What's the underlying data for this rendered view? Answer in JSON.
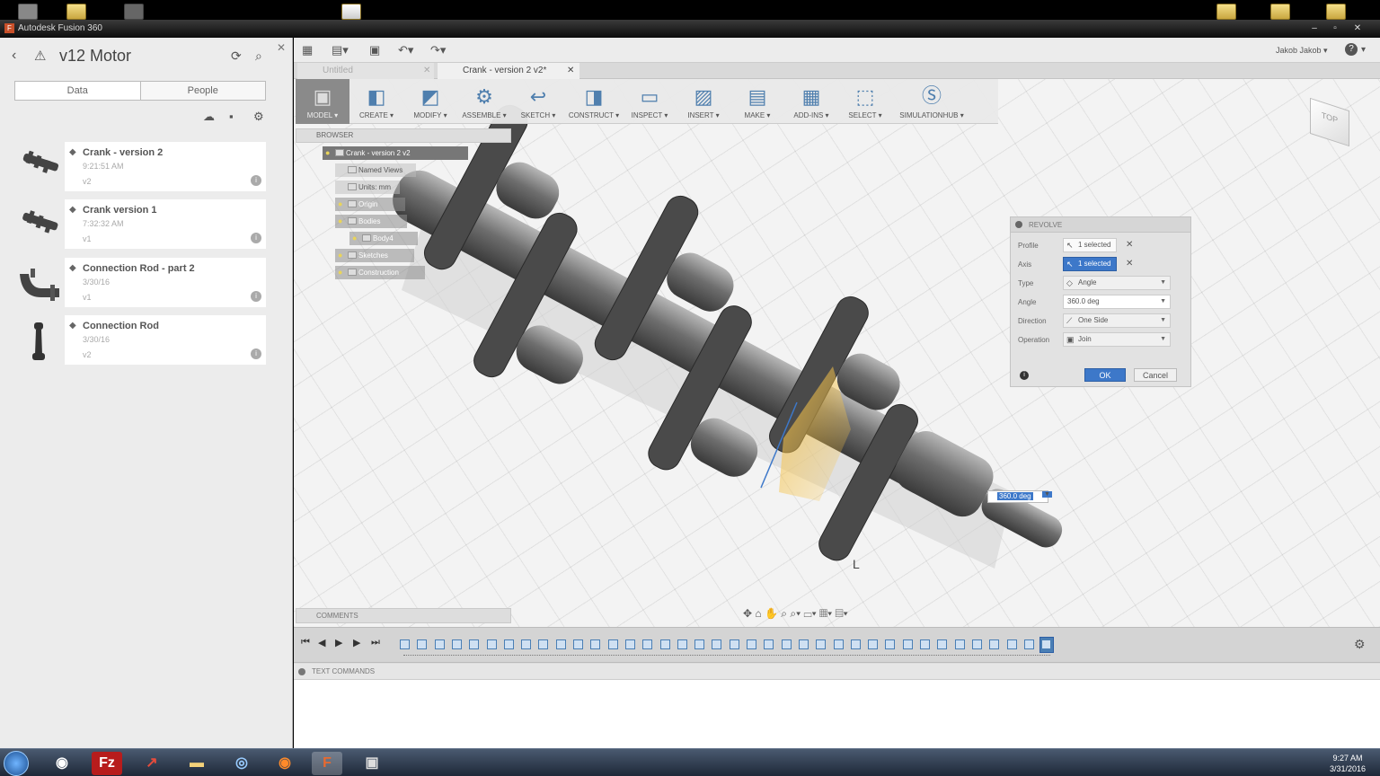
{
  "window": {
    "title": "Autodesk Fusion 360"
  },
  "data_panel": {
    "project_title": "v12 Motor",
    "tabs": [
      {
        "label": "Data"
      },
      {
        "label": "People"
      }
    ],
    "files": [
      {
        "name": "Crank - version 2",
        "time": "9:21:51 AM",
        "version": "v2"
      },
      {
        "name": "Crank version 1",
        "time": "7:32:32 AM",
        "version": "v1"
      },
      {
        "name": "Connection Rod - part 2",
        "time": "3/30/16",
        "version": "v1"
      },
      {
        "name": "Connection Rod",
        "time": "3/30/16",
        "version": "v2"
      }
    ]
  },
  "header": {
    "user": "Jakob Jakob ▾"
  },
  "doc_tabs": [
    {
      "label": "Untitled"
    },
    {
      "label": "Crank - version 2 v2*"
    }
  ],
  "toolbar": [
    {
      "label": "MODEL ▾",
      "icon": "model-icon",
      "glyph": "▣"
    },
    {
      "label": "CREATE ▾",
      "icon": "create-icon",
      "glyph": "◧"
    },
    {
      "label": "MODIFY ▾",
      "icon": "modify-icon",
      "glyph": "◩"
    },
    {
      "label": "ASSEMBLE ▾",
      "icon": "assemble-icon",
      "glyph": "⚙"
    },
    {
      "label": "SKETCH ▾",
      "icon": "sketch-icon",
      "glyph": "↩"
    },
    {
      "label": "CONSTRUCT ▾",
      "icon": "construct-icon",
      "glyph": "◨"
    },
    {
      "label": "INSPECT ▾",
      "icon": "inspect-icon",
      "glyph": "▭"
    },
    {
      "label": "INSERT ▾",
      "icon": "insert-icon",
      "glyph": "▨"
    },
    {
      "label": "MAKE ▾",
      "icon": "make-icon",
      "glyph": "▤"
    },
    {
      "label": "ADD-INS ▾",
      "icon": "addins-icon",
      "glyph": "▦"
    },
    {
      "label": "SELECT ▾",
      "icon": "select-icon",
      "glyph": "⬚"
    },
    {
      "label": "SIMULATIONHUB ▾",
      "icon": "simulationhub-icon",
      "glyph": "Ⓢ"
    }
  ],
  "browser": {
    "title": "BROWSER",
    "root": "Crank - version 2 v2",
    "nodes": [
      "Named Views",
      "Units: mm",
      "Origin",
      "Bodies",
      "Body4",
      "Sketches",
      "Construction"
    ]
  },
  "viewcube": {
    "face": "TOP"
  },
  "revolve": {
    "title": "REVOLVE",
    "rows": [
      {
        "label": "Profile",
        "value": "1 selected"
      },
      {
        "label": "Axis",
        "value": "1 selected"
      },
      {
        "label": "Type",
        "value": "Angle"
      },
      {
        "label": "Angle",
        "value": "360.0 deg"
      },
      {
        "label": "Direction",
        "value": "One Side"
      },
      {
        "label": "Operation",
        "value": "Join"
      }
    ],
    "ok": "OK",
    "cancel": "Cancel"
  },
  "angle_input": "360.0 deg",
  "comments": "COMMENTS",
  "text_commands": "TEXT COMMANDS",
  "clock": {
    "time": "9:27 AM",
    "date": "3/31/2016"
  },
  "colors": {
    "accent": "#3d78c9",
    "panel": "#ececec"
  }
}
